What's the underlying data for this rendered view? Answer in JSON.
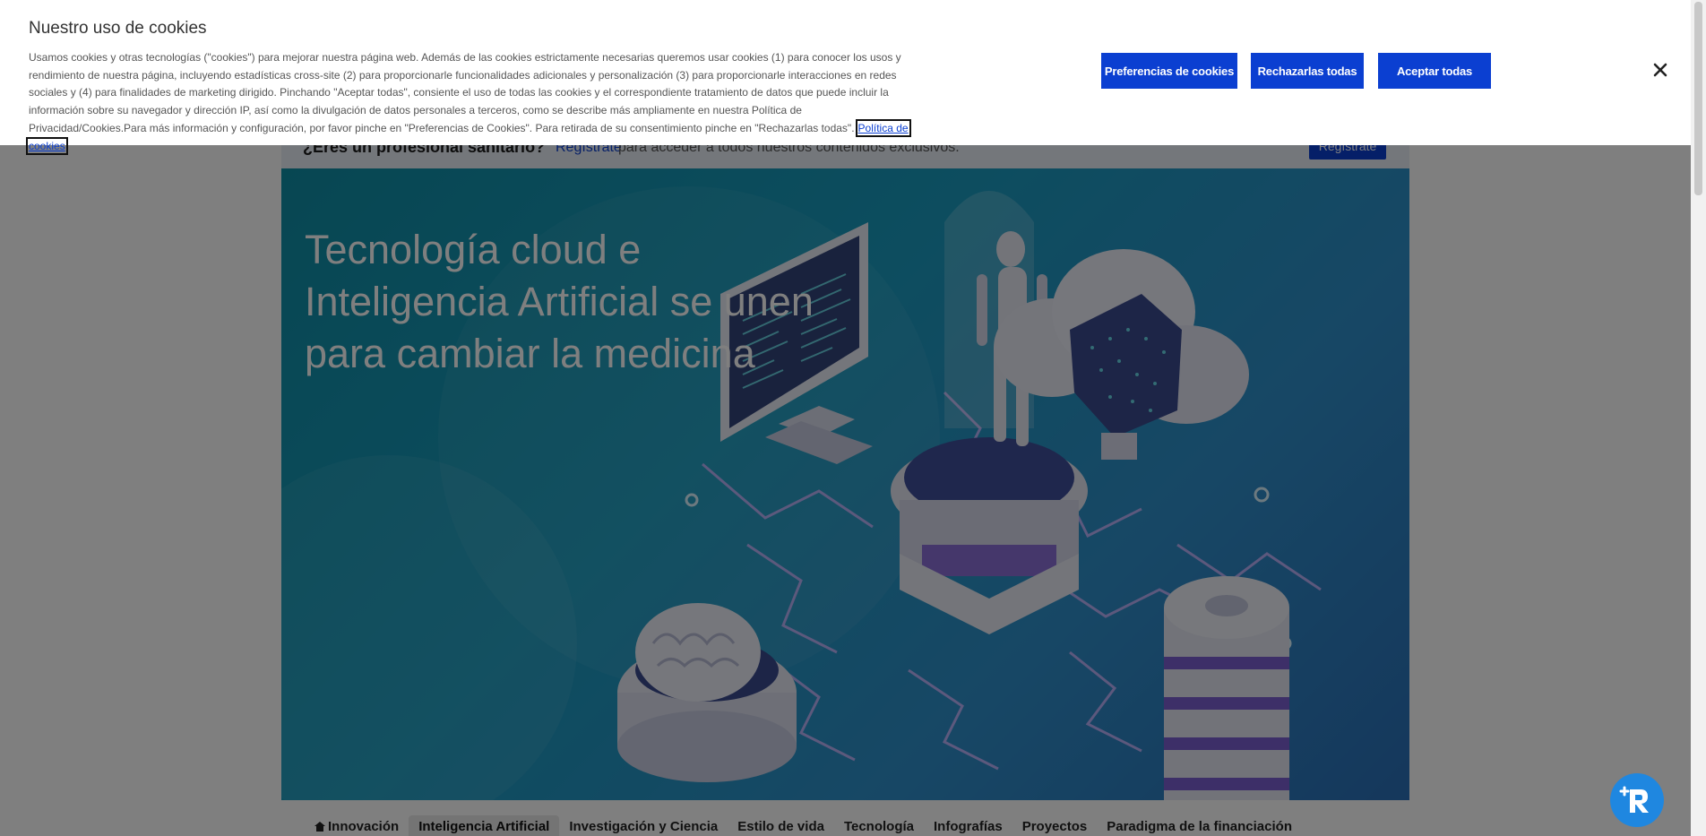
{
  "banner": {
    "title": "Nuestro uso de cookies",
    "text": "Usamos cookies y otras tecnologías (\"cookies\") para mejorar nuestra página web. Además de las cookies estrictamente necesarias queremos usar cookies (1) para conocer los usos y rendimiento de nuestra página, incluyendo estadísticas cross-site (2) para proporcionarle funcionalidades adicionales y personalización (3) para proporcionarle interacciones en redes sociales y (4) para finalidades de marketing dirigido. Pinchando \"Aceptar todas\", consiente el uso de todas las cookies y el correspondiente tratamiento de datos que puede incluir la información sobre su navegador y dirección IP, así como la divulgación de datos personales a terceros, como se describe más ampliamente en nuestra Política de Privacidad/Cookies.Para más información y configuración, por favor pinche en \"Preferencias de Cookies\". Para retirada de su consentimiento pinche en \"Rechazarlas todas\".",
    "policy_link": "Política de cookies",
    "preferences_label": "Preferencias de cookies",
    "reject_label": "Rechazarlas todas",
    "accept_label": "Aceptar todas",
    "close_icon": "close-icon"
  },
  "pro_strip": {
    "question": "¿Eres un profesional sanitario?",
    "register_link": "Regístrate",
    "rest": "para acceder a todos nuestros contenidos exclusivos.",
    "register_button": "Regístrate"
  },
  "hero": {
    "title": "Tecnología cloud e Inteligencia Artificial se unen para cambiar la medicina"
  },
  "nav": {
    "items": [
      {
        "label": "Innovación",
        "icon": "home-icon"
      },
      {
        "label": "Inteligencia Artificial",
        "active": true
      },
      {
        "label": "Investigación y Ciencia"
      },
      {
        "label": "Estilo de vida"
      },
      {
        "label": "Tecnología"
      },
      {
        "label": "Infografías"
      },
      {
        "label": "Proyectos"
      },
      {
        "label": "Paradigma de la financiación"
      }
    ]
  },
  "chat_fab": {
    "icon": "chat-assistant-icon"
  },
  "colors": {
    "accent": "#0b3fd1",
    "fab": "#1f87e0",
    "hero_start": "#0f8ea5",
    "hero_end": "#2a6fb8"
  }
}
